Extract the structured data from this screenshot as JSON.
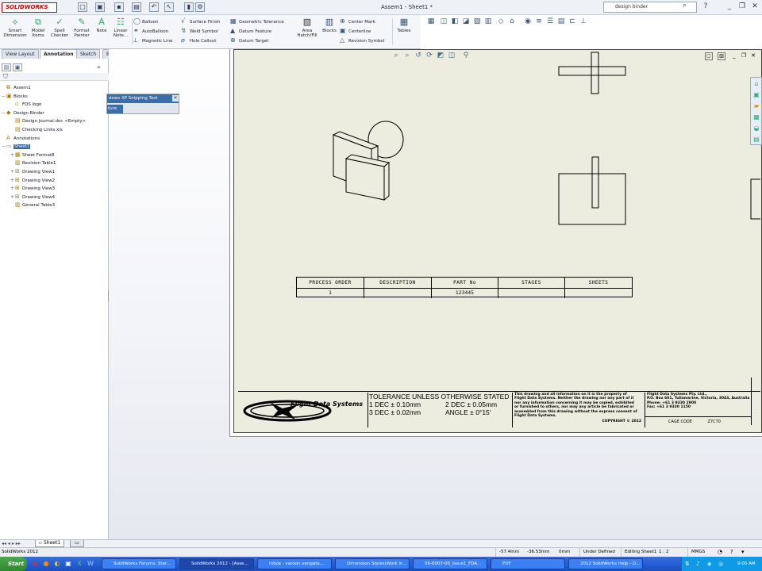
{
  "app": {
    "logo": "SOLIDWORKS",
    "document_title": "Assem1 - Sheet1 *"
  },
  "search": {
    "value": "design binder"
  },
  "ribbon": {
    "big": [
      {
        "id": "smart",
        "label": "Smart\nDimension"
      },
      {
        "id": "model",
        "label": "Model\nItems"
      },
      {
        "id": "spell",
        "label": "Spell\nChecker"
      },
      {
        "id": "format",
        "label": "Format\nPainter"
      },
      {
        "id": "note",
        "label": "Note"
      },
      {
        "id": "linear",
        "label": "Linear\nNote..."
      }
    ],
    "col1": [
      "Balloon",
      "AutoBalloon",
      "Magnetic Line"
    ],
    "col2": [
      "Surface Finish",
      "Weld Symbol",
      "Hole Callout"
    ],
    "col3": [
      "Geometric Tolerance",
      "Datum Feature",
      "Datum Target"
    ],
    "area": "Area\nHatch/Fill",
    "blocks": "Blocks",
    "col4": [
      "Center Mark",
      "Centerline",
      "Revision Symbol"
    ],
    "tables": "Tables"
  },
  "tabs": [
    "View Layout",
    "Annotation",
    "Sketch",
    "Evaluate"
  ],
  "active_tab": "Annotation",
  "tree": [
    {
      "d": 0,
      "ex": "",
      "icon": "assembly",
      "label": "Assem1"
    },
    {
      "d": 0,
      "ex": "−",
      "icon": "folder",
      "label": "Blocks"
    },
    {
      "d": 1,
      "ex": "",
      "icon": "block",
      "label": "FDS logo"
    },
    {
      "d": 0,
      "ex": "−",
      "icon": "binder",
      "label": "Design Binder"
    },
    {
      "d": 1,
      "ex": "",
      "icon": "doc",
      "label": "Design Journal.doc <Empty>"
    },
    {
      "d": 1,
      "ex": "",
      "icon": "doc",
      "label": "Checking Links.xls"
    },
    {
      "d": 0,
      "ex": "",
      "icon": "annotation",
      "label": "Annotations"
    },
    {
      "d": 0,
      "ex": "−",
      "icon": "sheet",
      "label": "Sheet1",
      "selected": true
    },
    {
      "d": 1,
      "ex": "+",
      "icon": "format",
      "label": "Sheet Format8"
    },
    {
      "d": 1,
      "ex": "",
      "icon": "table",
      "label": "Revision Table1"
    },
    {
      "d": 1,
      "ex": "+",
      "icon": "view",
      "label": "Drawing View1"
    },
    {
      "d": 1,
      "ex": "+",
      "icon": "view",
      "label": "Drawing View2"
    },
    {
      "d": 1,
      "ex": "+",
      "icon": "view",
      "label": "Drawing View3"
    },
    {
      "d": 1,
      "ex": "+",
      "icon": "view",
      "label": "Drawing View4"
    },
    {
      "d": 1,
      "ex": "",
      "icon": "table",
      "label": "General Table3"
    }
  ],
  "snipping_tool": {
    "title": "dows XP Snipping Tool",
    "button": "ture"
  },
  "bom": {
    "headers": [
      "PROCESS ORDER",
      "DESCRIPTION",
      "PART No",
      "STAGES",
      "SHEETS"
    ],
    "row": [
      "1",
      "",
      "123445",
      "",
      ""
    ]
  },
  "title_block": {
    "logo_text": "Flight Data Systems",
    "tolerance": {
      "heading": "TOLERANCE UNLESS OTHERWISE STATED",
      "l1a": "1 DEC ± 0.10mm",
      "l1b": "2 DEC ± 0.05mm",
      "l2a": "3 DEC ± 0.02mm",
      "l2b": "ANGLE ± 0°15'"
    },
    "legal": [
      "This drawing and all information on it is the property of",
      "Flight Data Systems. Neither the drawing nor any part of it",
      "nor any information concerning it may be copied, exhibited",
      "or furnished to others, nor may any article be fabricated or",
      "assembled from this drawing without the express consent of",
      "Flight Data Systems."
    ],
    "copyright": "COPYRIGHT © 2012",
    "company": [
      "Flight Data Systems Pty. Ltd.,",
      "P.O. Box 601, Tullamarine, Victoria, 3043, Australia",
      "Phone: +61 3 9330 2900",
      "Fax:     +61 3 9330 1150"
    ],
    "cage_label": "CAGE CODE",
    "cage_code": "Z7C70"
  },
  "sheet_tab": "Sheet1",
  "status": {
    "app": "SolidWorks 2012",
    "x": "-57.4mm",
    "y": "-36.53mm",
    "z": "0mm",
    "state": "Under Defined",
    "editing": "Editing Sheet1",
    "scale": "1 : 2",
    "units": "MMGS"
  },
  "taskbar": {
    "start": "Start",
    "items": [
      "SolidWorks Forums: Star...",
      "SolidWorks 2012 - [Asse...",
      "Inbox - varoon.vengata...",
      "Dimension Styles(Work in...",
      "06-0007-00_issue1_FDA...",
      "PDF",
      "2012 SolidWorks Help - D..."
    ],
    "active_index": 1,
    "clock": "9:05 AM"
  }
}
